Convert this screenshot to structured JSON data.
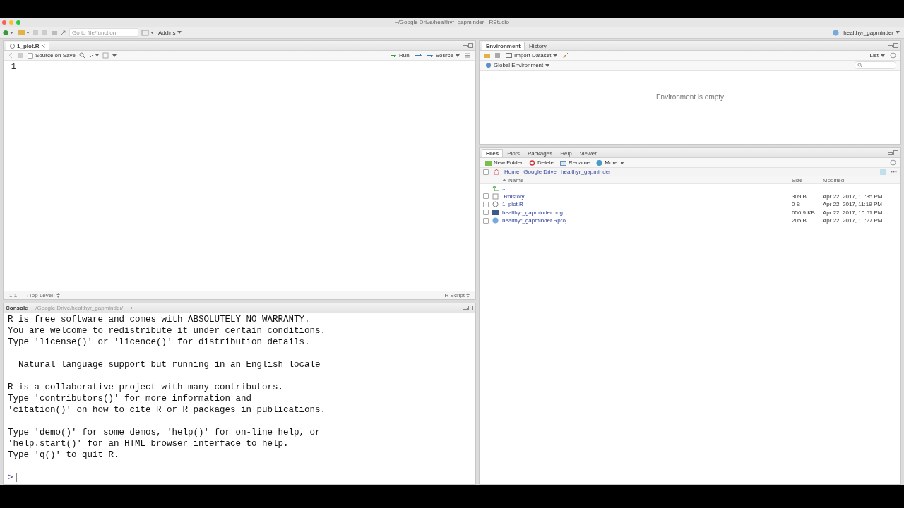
{
  "window": {
    "title": "~/Google Drive/healthyr_gapminder - RStudio"
  },
  "toolbar": {
    "goto_placeholder": "Go to file/function",
    "addins": "Addins",
    "project": "healthyr_gapminder"
  },
  "editor": {
    "tabs": [
      {
        "label": "1_plot.R",
        "selected": true
      }
    ],
    "source_on_save": {
      "label": "Source on Save",
      "checked": false
    },
    "run": "Run",
    "source": "Source",
    "line_numbers": [
      "1"
    ],
    "status": {
      "position": "1:1",
      "scope": "(Top Level)",
      "file_type": "R Script"
    }
  },
  "console": {
    "title": "Console",
    "path": "~/Google Drive/healthyr_gapminder/",
    "prompt": ">",
    "paragraphs": [
      {
        "lines": [
          "R is free software and comes with ABSOLUTELY NO WARRANTY.",
          "You are welcome to redistribute it under certain conditions.",
          "Type 'license()' or 'licence()' for distribution details."
        ]
      },
      {
        "lines": [
          "  Natural language support but running in an English locale"
        ]
      },
      {
        "lines": [
          "R is a collaborative project with many contributors.",
          "Type 'contributors()' for more information and",
          "'citation()' on how to cite R or R packages in publications."
        ]
      },
      {
        "lines": [
          "Type 'demo()' for some demos, 'help()' for on-line help, or",
          "'help.start()' for an HTML browser interface to help.",
          "Type 'q()' to quit R."
        ]
      }
    ]
  },
  "environment": {
    "tabs": [
      {
        "label": "Environment",
        "selected": true
      },
      {
        "label": "History",
        "selected": false
      }
    ],
    "import": "Import Dataset",
    "view": "List",
    "scope": "Global Environment",
    "empty_message": "Environment is empty"
  },
  "files": {
    "tabs": [
      {
        "label": "Files",
        "selected": true
      },
      {
        "label": "Plots",
        "selected": false
      },
      {
        "label": "Packages",
        "selected": false
      },
      {
        "label": "Help",
        "selected": false
      },
      {
        "label": "Viewer",
        "selected": false
      }
    ],
    "actions": [
      {
        "kind": "folder",
        "label": "New Folder"
      },
      {
        "kind": "delete",
        "label": "Delete"
      },
      {
        "kind": "rename",
        "label": "Rename"
      },
      {
        "kind": "more",
        "label": "More"
      }
    ],
    "select_all": {
      "checked": false
    },
    "breadcrumb": [
      "Home",
      "Google Drive",
      "healthyr_gapminder"
    ],
    "columns": {
      "name": "Name",
      "size": "Size",
      "modified": "Modified"
    },
    "up": "..",
    "rows": [
      {
        "kind": "history",
        "name": ".Rhistory",
        "size": "309 B",
        "modified": "Apr 22, 2017, 10:35 PM",
        "checked": false
      },
      {
        "kind": "r",
        "name": "1_plot.R",
        "size": "0 B",
        "modified": "Apr 22, 2017, 11:19 PM",
        "checked": false
      },
      {
        "kind": "png",
        "name": "healthyr_gapminder.png",
        "size": "656.9 KB",
        "modified": "Apr 22, 2017, 10:51 PM",
        "checked": false
      },
      {
        "kind": "rproj",
        "name": "healthyr_gapminder.Rproj",
        "size": "205 B",
        "modified": "Apr 22, 2017, 10:27 PM",
        "checked": false
      }
    ]
  }
}
